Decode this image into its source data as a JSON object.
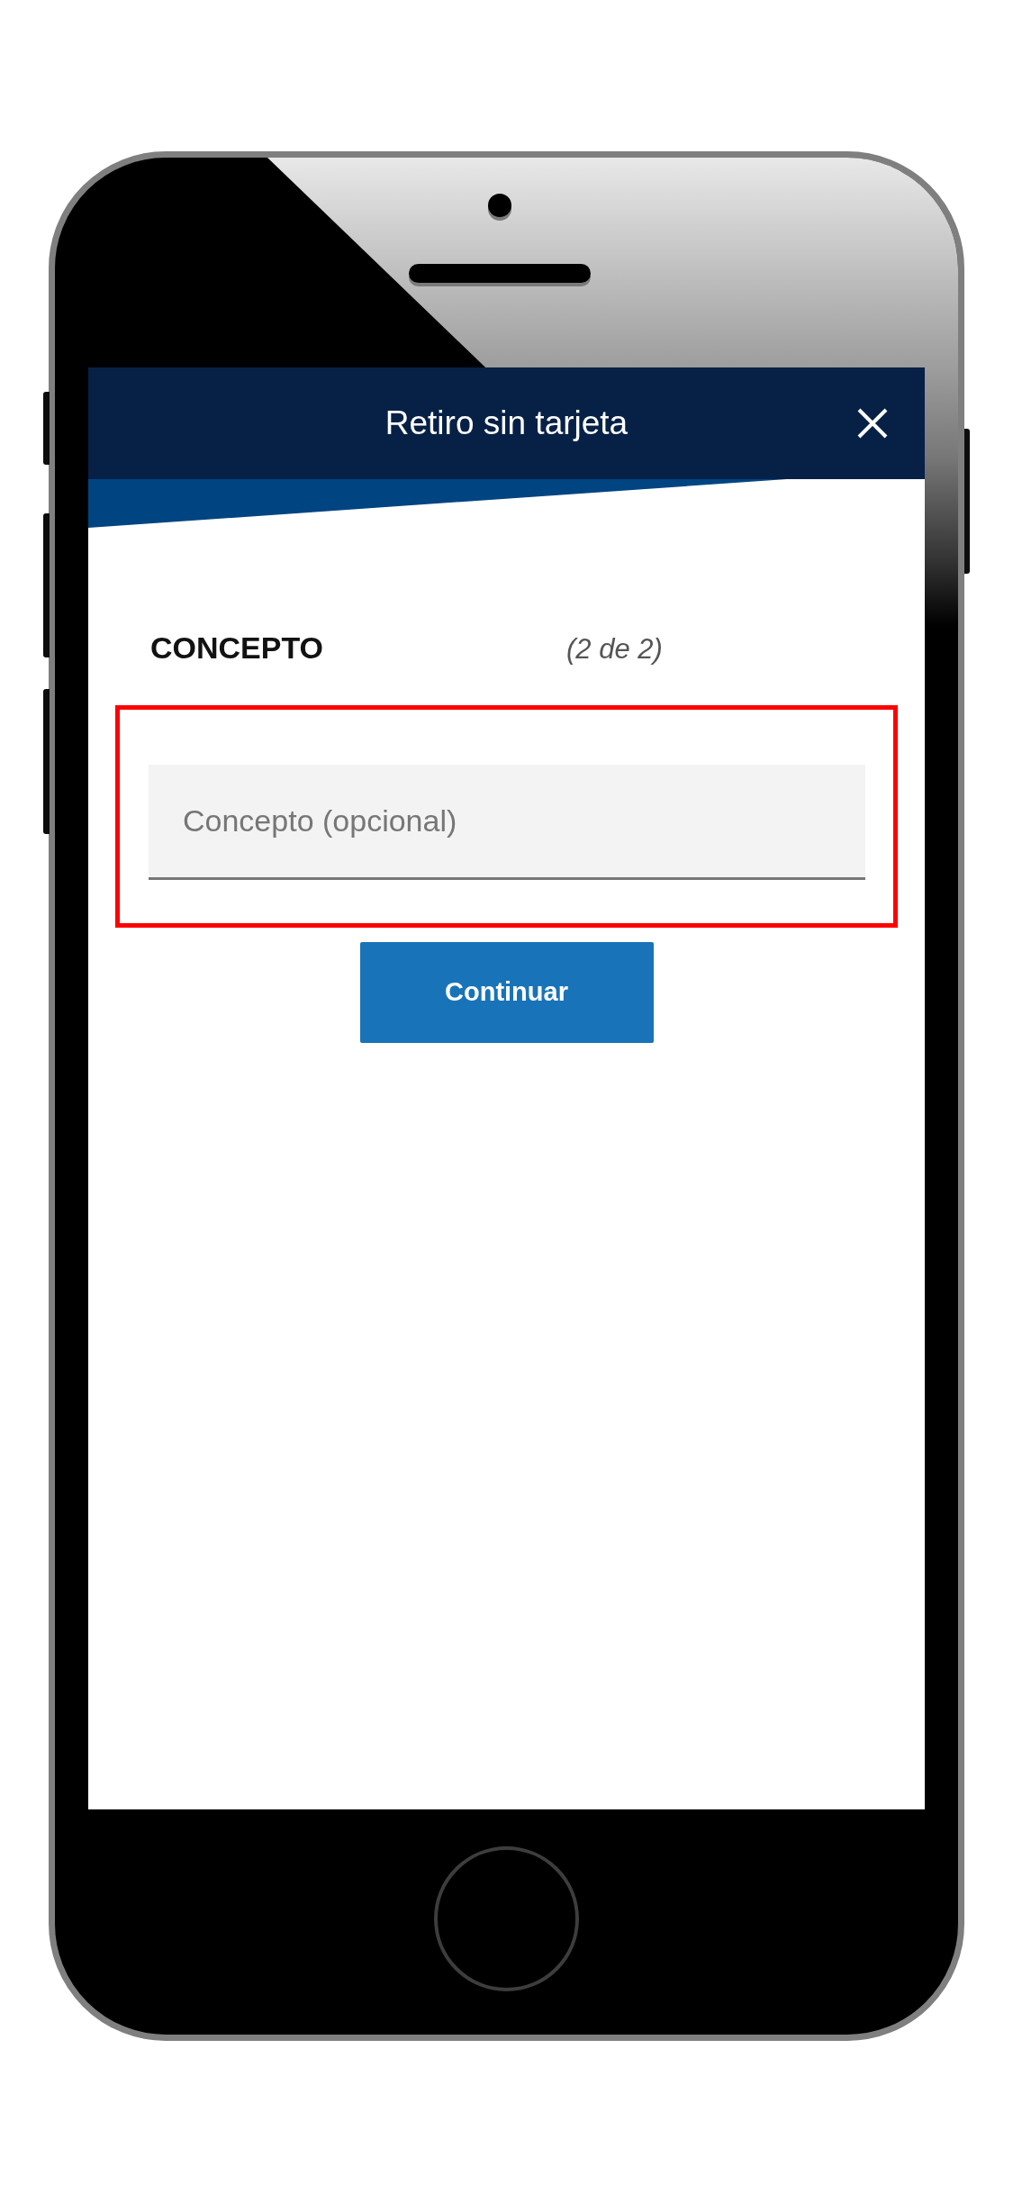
{
  "header": {
    "title": "Retiro sin tarjeta"
  },
  "section": {
    "title": "CONCEPTO",
    "step": "(2 de 2)"
  },
  "concept_field": {
    "placeholder": "Concepto (opcional)",
    "highlighted": true
  },
  "primary_button": {
    "label": "Continuar"
  }
}
